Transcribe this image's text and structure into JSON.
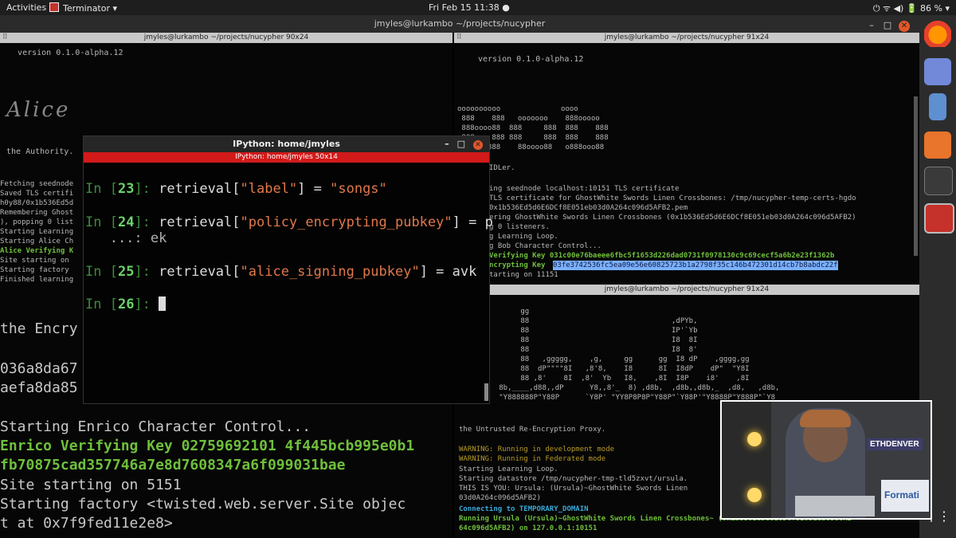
{
  "topbar": {
    "activities": "Activities",
    "app": "Terminator ▾",
    "clock": "Fri Feb 15  11:38 ●",
    "tray": "⏻   ᯤ  ◀)  🔋 86 %  ▾"
  },
  "window_title": "jmyles@lurkambo ~/projects/nucypher",
  "left_pane": {
    "title": "jmyles@lurkambo ~/projects/nucypher 90x24",
    "lines": [
      "   version 0.1.0-alpha.12",
      "the Authority.",
      "Fetching seednode",
      "Saved TLS certifi",
      "h0y88/0x1b536Ed5d",
      "Remembering Ghost",
      "), popping 0 list",
      "Starting Learning",
      "Starting Alice Ch",
      "Site starting on",
      "Starting factory",
      "Finished learning"
    ],
    "alice_verifying": "Alice Verifying K",
    "big_lines": [
      "the Encry",
      "036a8da67",
      "aefa8da85",
      "Starting Enrico Character Control...",
      "Site starting on 5151",
      "Starting factory <twisted.web.server.Site objec",
      "t at 0x7f9fed11e2e8>"
    ],
    "enrico_key_1": "Enrico Verifying Key 02759692101 4f445bcb995e0b1",
    "enrico_key_2": "fb70875cad357746a7e8d7608347a6f099031bae"
  },
  "right_top": {
    "title": "jmyles@lurkambo ~/projects/nucypher 91x24",
    "lines": [
      "version 0.1.0-alpha.12",
      "oooooooooo              oooo",
      " 888    888   ooooooo    888ooooo",
      " 888oooo88  888     888  888    888",
      " 888    888 888     888  888    888",
      "o888ooo888    88oooo88   o888ooo88",
      "IDLer.",
      "ing seednode localhost:10151 TLS certificate",
      "TLS certificate for GhostWhite Swords Linen Crossbones: /tmp/nucypher-temp-certs-hgdo",
      "0x1b536Ed5d6E6DCf8E051eb03d0A264c096d5AFB2.pem",
      "ering GhostWhite Swords Linen Crossbones (0x1b536Ed5d6E6DCf8E051eb03d0A264c096d5AFB2)",
      "g 0 listeners.",
      "g Learning Loop.",
      "g Bob Character Control...",
      "tarting on 11151"
    ],
    "bob_key": "Verifying Key 031c00e76baeee6fbc5f1653d226dad0731f0978130c9c69cecf5a6b2e23f1362b",
    "enc_label": "ncrypting Key",
    "enc_key": "03fe3742536fc5ea09e56e60825723b1a2798f35c146b472301d14cb7b8abdc22f"
  },
  "right_bottom": {
    "title": "jmyles@lurkambo ~/projects/nucypher 91x24",
    "art": [
      "        gg",
      "        88                                 ,dPYb,",
      "        88                                 IP'`Yb",
      "        88                                 I8  8I",
      "        88                                 I8  8'",
      "        88   ,ggggg,    ,g,     gg      gg  I8 dP    ,gggg,gg",
      "        88  dP\"\"\"\"8I   ,8'8,    I8      8I  I8dP    dP\"  \"Y8I",
      "        88 ,8'    8I  ,8'  Yb   I8,    ,8I  I8P    i8'    ,8I",
      "   8b,____,d88,,dP      Y8,,8'_  8) ,d8b,  ,d8b,,d8b,_  ,d8,   ,d8b,",
      "   \"Y888888P\"Y88P      `Y8P' \"YY8P8P8P\"Y88P\"`Y88P'\"Y8888P\"Y888P\"`Y8"
    ],
    "lines": [
      "the Untrusted Re-Encryption Proxy.",
      "Starting Learning Loop.",
      "Starting datastore /tmp/nucypher-tmp-tld5zxvt/ursula.",
      "THIS IS YOU: Ursula: (Ursula)~GhostWhite Swords Linen",
      "03d0A264c096d5AFB2)"
    ],
    "warn1": "WARNING: Running in development mode",
    "warn2": "WARNING: Running in Federated mode",
    "connecting": "Connecting to TEMPORARY_DOMAIN",
    "running1": "Running Ursula (Ursula)~GhostWhite Swords Linen Crossbones~ (0x1b536Ed5d6E6DCf8E051eb03d0A2",
    "running2": "64c096d5AFB2) on 127.0.0.1:10151"
  },
  "ipython": {
    "title": "IPython: home/jmyles",
    "subtitle": "IPython: home/jmyles 50x14",
    "cells": [
      {
        "prompt": "In [",
        "num": "23",
        "close": "]: ",
        "pre": "retrieval[",
        "key": "\"label\"",
        "post": "] = ",
        "val": "\"songs\""
      },
      {
        "prompt": "In [",
        "num": "24",
        "close": "]: ",
        "pre": "retrieval[",
        "key": "\"policy_encrypting_pubkey\"",
        "post": "] = p",
        "val": ""
      },
      {
        "prompt": "In [",
        "num": "25",
        "close": "]: ",
        "pre": "retrieval[",
        "key": "\"alice_signing_pubkey\"",
        "post": "] = avk",
        "val": ""
      }
    ],
    "continuation": "   ...: ek",
    "next_prompt": "In [",
    "next_num": "26",
    "next_close": "]: "
  },
  "webcam": {
    "banner": "ETHDENVER",
    "sign": "Formati"
  }
}
